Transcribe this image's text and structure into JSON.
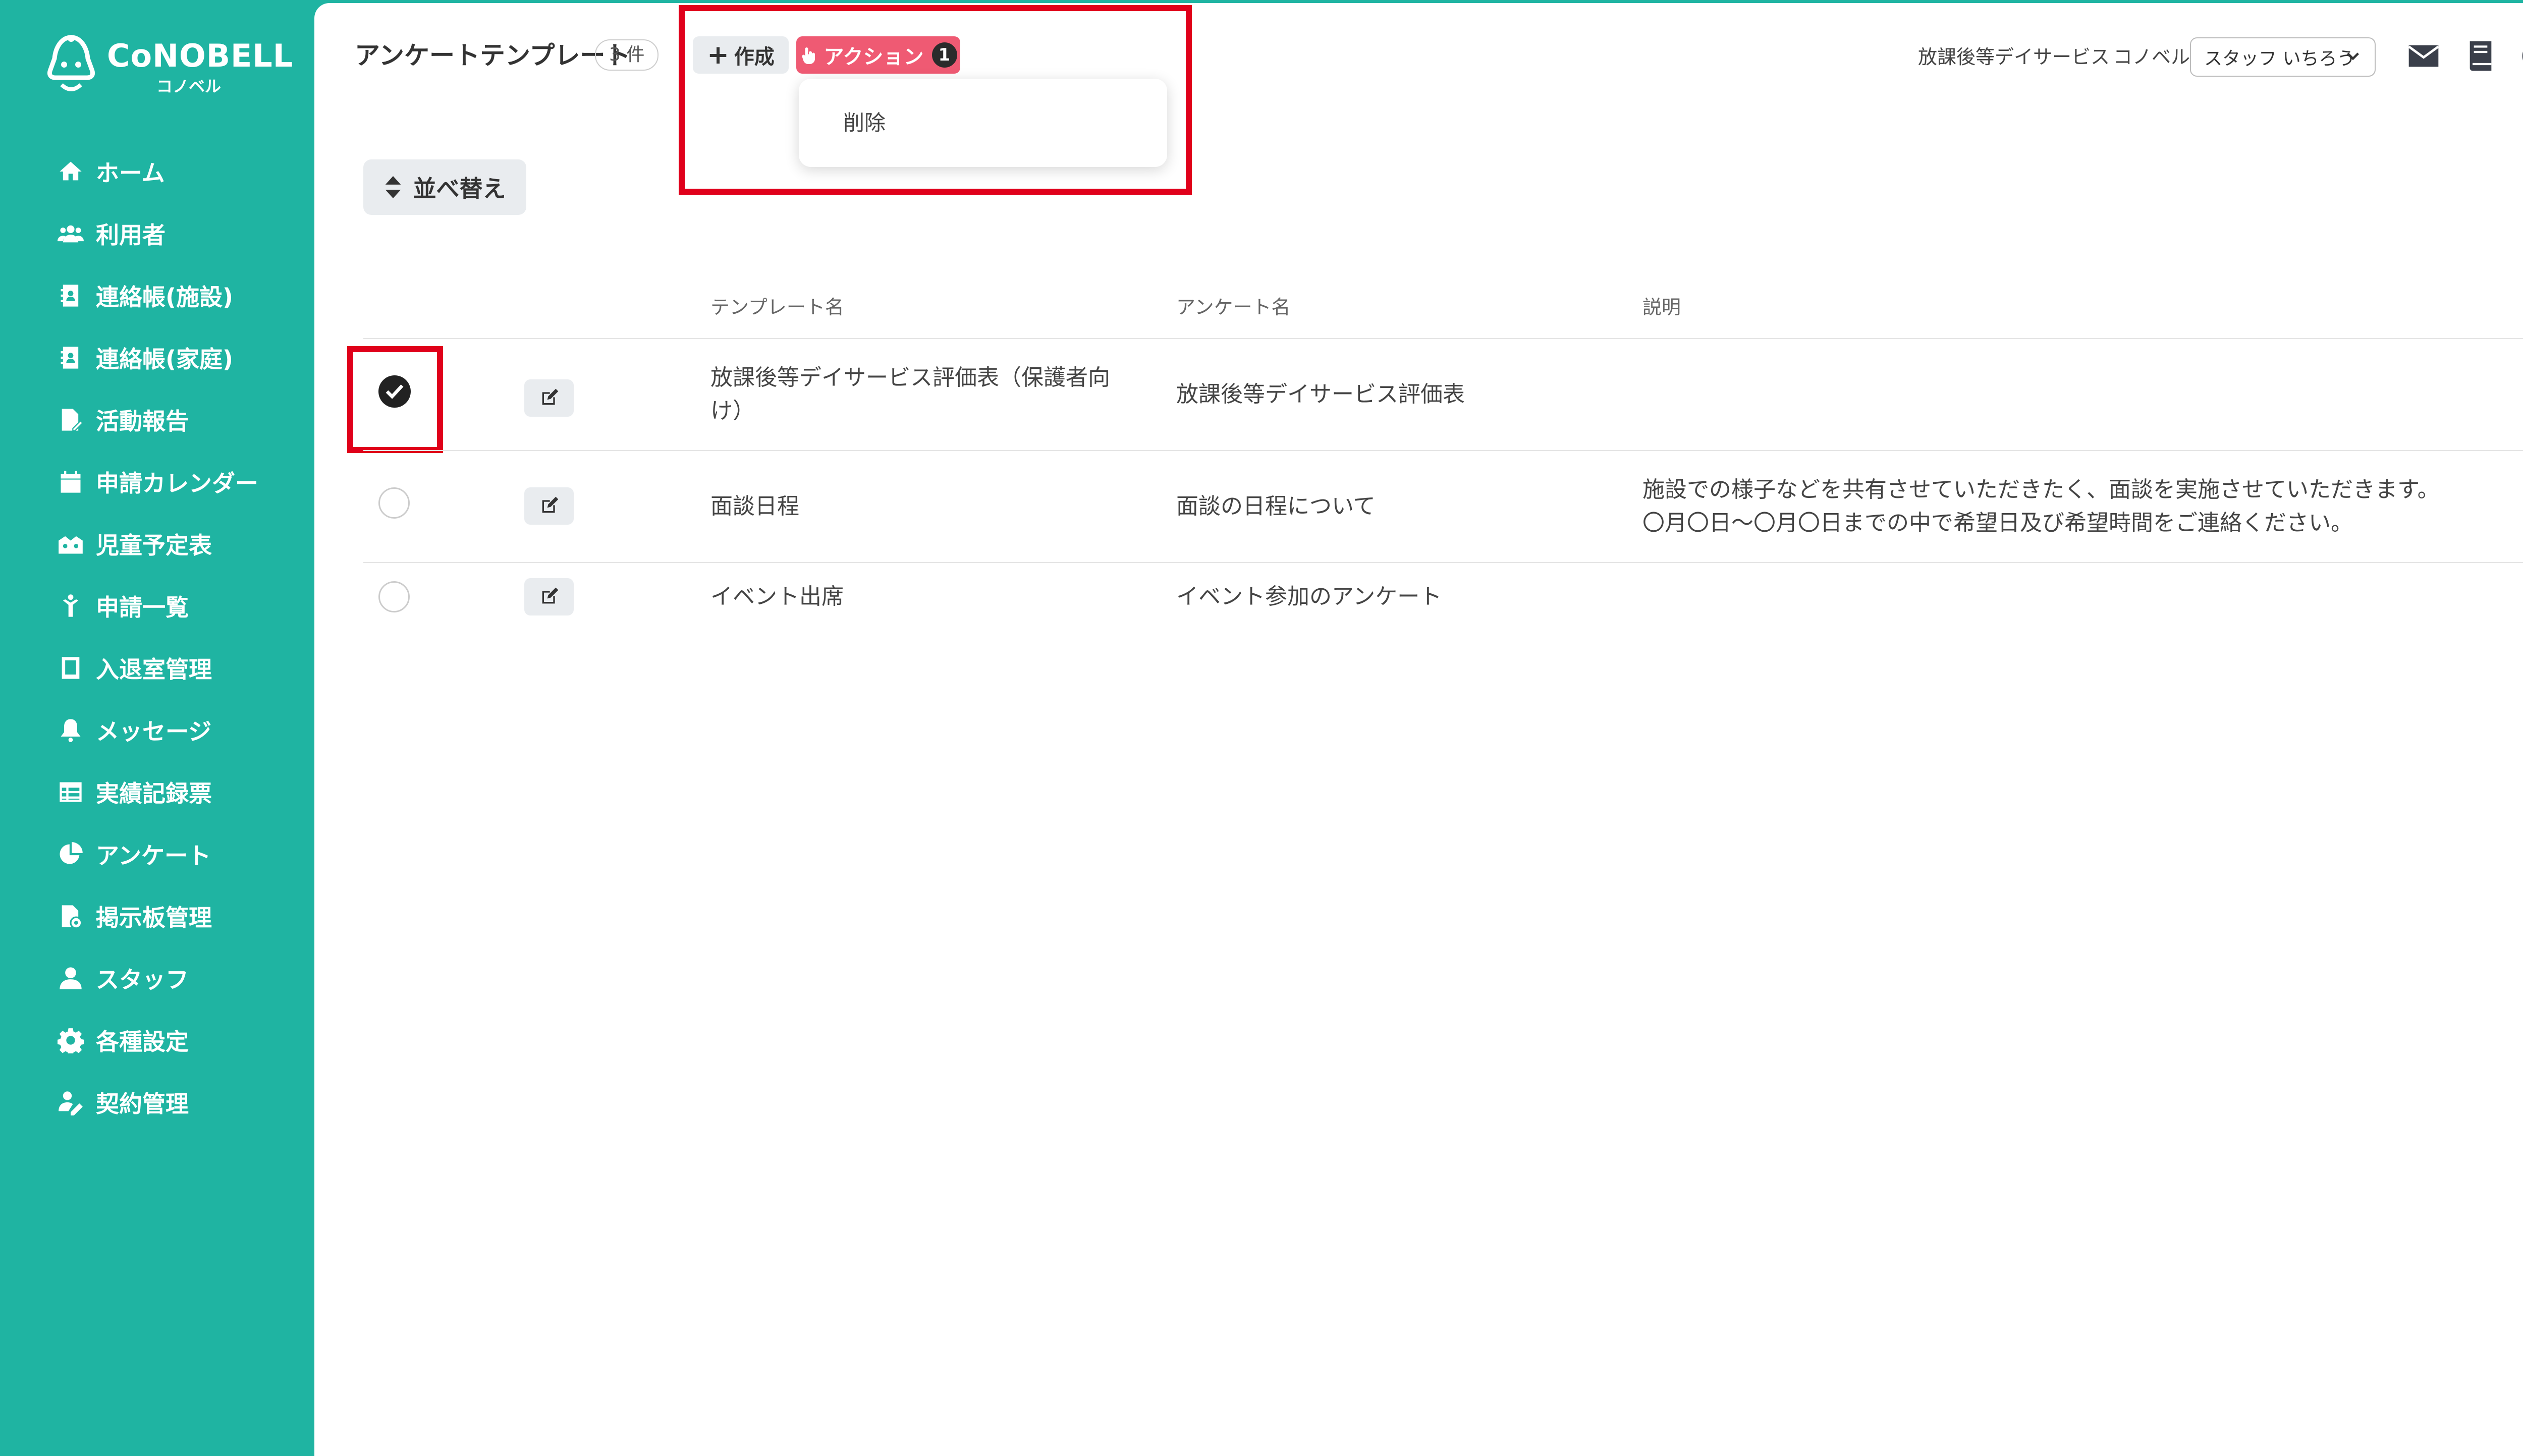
{
  "app": {
    "logo_text": "CoNOBELL",
    "logo_sub": "コノベル"
  },
  "sidebar": {
    "items": [
      {
        "label": "ホーム",
        "icon": "home-icon"
      },
      {
        "label": "利用者",
        "icon": "users-icon"
      },
      {
        "label": "連絡帳(施設)",
        "icon": "contact-book-icon"
      },
      {
        "label": "連絡帳(家庭)",
        "icon": "contact-book-icon"
      },
      {
        "label": "活動報告",
        "icon": "report-icon"
      },
      {
        "label": "申請カレンダー",
        "icon": "calendar-icon"
      },
      {
        "label": "児童予定表",
        "icon": "children-schedule-icon"
      },
      {
        "label": "申請一覧",
        "icon": "application-list-icon"
      },
      {
        "label": "入退室管理",
        "icon": "tablet-icon"
      },
      {
        "label": "メッセージ",
        "icon": "bell-icon"
      },
      {
        "label": "実績記録票",
        "icon": "table-icon"
      },
      {
        "label": "アンケート",
        "icon": "pie-chart-icon"
      },
      {
        "label": "掲示板管理",
        "icon": "file-settings-icon"
      },
      {
        "label": "スタッフ",
        "icon": "user-icon"
      },
      {
        "label": "各種設定",
        "icon": "gear-icon"
      },
      {
        "label": "契約管理",
        "icon": "contract-icon"
      }
    ]
  },
  "header": {
    "title": "アンケートテンプレート",
    "count": "3 件",
    "create_label": "作成",
    "action_label": "アクション",
    "action_count": "1",
    "dropdown_delete": "削除",
    "facility": "放課後等デイサービス",
    "company": "コノベル",
    "staff_select_value": "スタッフ いちろう"
  },
  "toolbar": {
    "sort_label": "並べ替え"
  },
  "table": {
    "headers": [
      "テンプレート名",
      "アンケート名",
      "説明"
    ],
    "rows": [
      {
        "checked": true,
        "template_name": "放課後等デイサービス評価表（保護者向け）",
        "survey_name": "放課後等デイサービス評価表",
        "description_line1": "",
        "description_line2": ""
      },
      {
        "checked": false,
        "template_name": "面談日程",
        "survey_name": "面談の日程について",
        "description_line1": "施設での様子などを共有させていただきたく、面談を実施させていただきます。",
        "description_line2": "〇月〇日～〇月〇日までの中で希望日及び希望時間をご連絡ください。"
      },
      {
        "checked": false,
        "template_name": "イベント出席",
        "survey_name": "イベント参加のアンケート",
        "description_line1": "",
        "description_line2": ""
      }
    ]
  },
  "colors": {
    "sidebar_bg": "#1fb4a2",
    "action_btn": "#ef5a73",
    "highlight_box": "#e0001b"
  }
}
